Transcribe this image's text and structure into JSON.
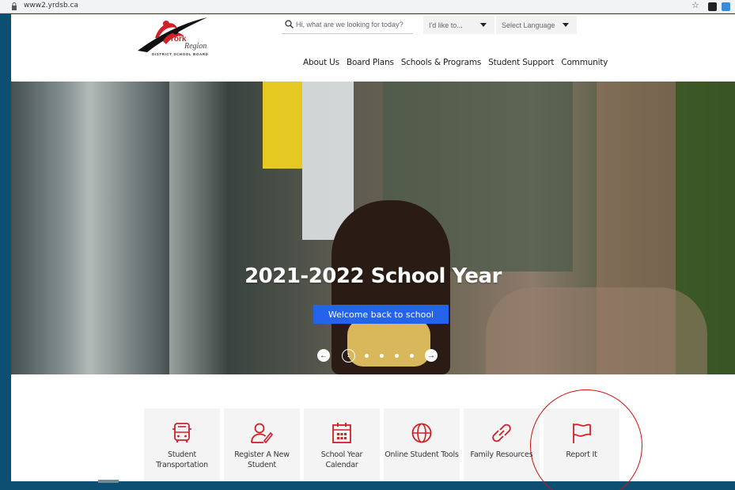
{
  "browser": {
    "url": "www2.yrdsb.ca"
  },
  "header": {
    "logo": {
      "line1": "York",
      "line2": "Region",
      "line3": "DISTRICT SCHOOL BOARD"
    },
    "search": {
      "placeholder": "Hi, what are we looking for today?"
    },
    "like_to": "I'd like to...",
    "language": "Select Language",
    "nav": [
      "About Us",
      "Board Plans",
      "Schools & Programs",
      "Student Support",
      "Community"
    ]
  },
  "hero": {
    "title": "2021-2022 School Year",
    "button": "Welcome back to school",
    "carousel": {
      "current": "1"
    }
  },
  "quick_links": [
    {
      "label": "Student Transportation",
      "icon": "bus-icon"
    },
    {
      "label": "Register A New Student",
      "icon": "user-edit-icon"
    },
    {
      "label": "School Year Calendar",
      "icon": "calendar-icon"
    },
    {
      "label": "Online Student Tools",
      "icon": "globe-icon"
    },
    {
      "label": "Family Resources",
      "icon": "link-icon"
    },
    {
      "label": "Report It",
      "icon": "flag-icon"
    }
  ],
  "colors": {
    "accent": "#d12027",
    "button": "#2563eb",
    "frame": "#0d4f73",
    "annotation": "#d10f0f"
  }
}
